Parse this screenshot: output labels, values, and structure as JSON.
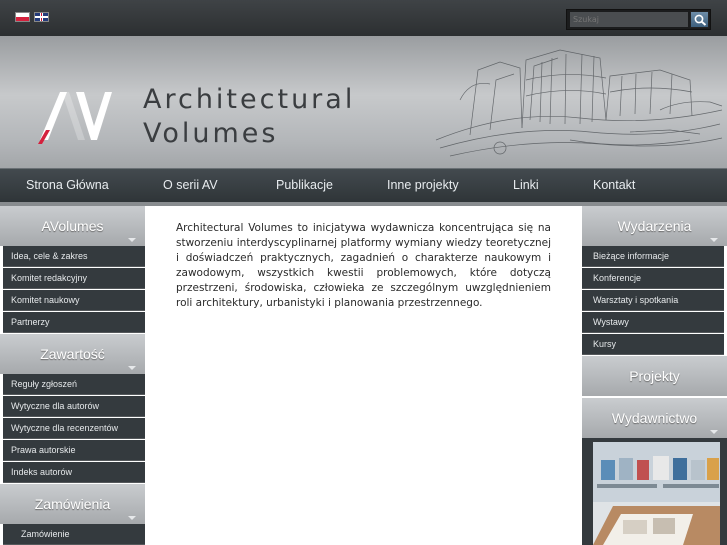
{
  "languages": [
    "pl",
    "en"
  ],
  "search": {
    "placeholder": "Szukaj"
  },
  "brand": {
    "line1": "Architectural",
    "line2": "Volumes"
  },
  "nav": [
    "Strona Główna",
    "O serii AV",
    "Publikacje",
    "Inne projekty",
    "Linki",
    "Kontakt"
  ],
  "left": {
    "sections": [
      {
        "title": "AVolumes",
        "items": [
          "Idea, cele & zakres",
          "Komitet redakcyjny",
          "Komitet naukowy",
          "Partnerzy"
        ]
      },
      {
        "title": "Zawartość",
        "items": [
          "Reguły zgłoszeń",
          "Wytyczne dla autorów",
          "Wytyczne dla recenzentów",
          "Prawa autorskie",
          "Indeks autorów"
        ]
      },
      {
        "title": "Zamówienia",
        "items": [
          "Zamówienie"
        ]
      }
    ]
  },
  "right": {
    "sections": [
      {
        "title": "Wydarzenia",
        "items": [
          "Bieżące informacje",
          "Konferencje",
          "Warsztaty i spotkania",
          "Wystawy",
          "Kursy"
        ]
      },
      {
        "title": "Projekty",
        "items": []
      },
      {
        "title": "Wydawnictwo",
        "items": []
      }
    ]
  },
  "main": {
    "text": "Architectural Volumes to inicjatywa wydawnicza koncentrująca się na stworzeniu interdyscyplinarnej platformy wymiany wiedzy teoretycznej i doświadczeń praktycznych, zagadnień o charakterze naukowym i zawodowym, wszystkich kwestii problemowych, które dotyczą przestrzeni, środowiska, człowieka ze szczególnym uwzględnieniem roli architektury, urbanistyki i planowania przestrzennego."
  },
  "colors": {
    "menu_bg": "#343a3e",
    "header_bg": "#b3b6b9",
    "accent_red": "#d4213d"
  }
}
